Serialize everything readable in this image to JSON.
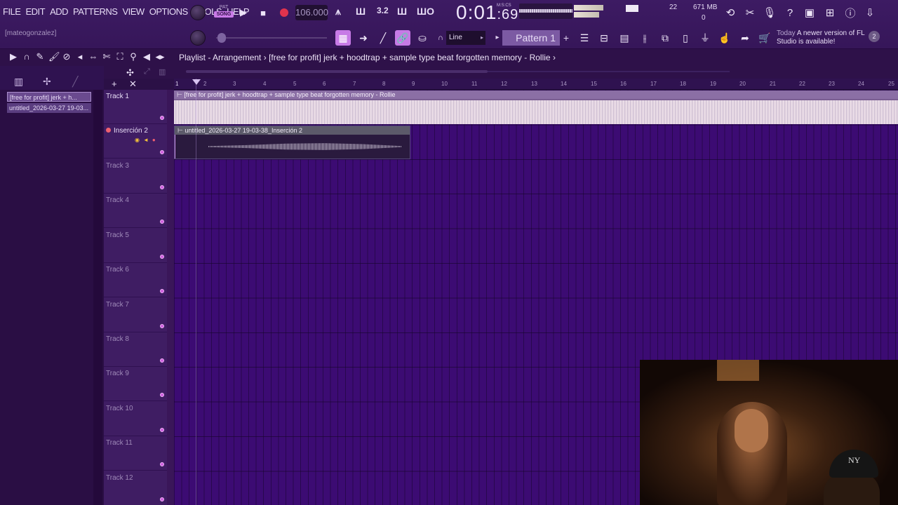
{
  "menu": [
    "FILE",
    "EDIT",
    "ADD",
    "PATTERNS",
    "VIEW",
    "OPTIONS",
    "TOOLS",
    "HELP"
  ],
  "user": "[mateogonzalez]",
  "transport": {
    "pat_label": "PAT",
    "song_label": "SONG",
    "tempo": "106.000",
    "clock_main": "0:01",
    "clock_ms": ":69",
    "clock_tag": "M:S:CS"
  },
  "meters": {
    "cpu_value": "22",
    "memory": "671 MB",
    "polyphony": "0"
  },
  "snap": {
    "value": "Line"
  },
  "pattern": {
    "name": "Pattern 1"
  },
  "news": {
    "today": "Today",
    "message": "A newer version of FL Studio is available!",
    "badge": "2"
  },
  "playlist": {
    "title": "Playlist - Arrangement",
    "separator": "›",
    "current_clip": "[free for profit] jerk + hoodtrap + sample type beat forgotten memory - Rollie"
  },
  "clip_browser": [
    "[free for profit] jerk + h...",
    "untitled_2026-03-27 19-03..."
  ],
  "ruler": [
    "2",
    "3",
    "4",
    "5",
    "6",
    "7",
    "8",
    "9",
    "10",
    "11",
    "12",
    "13",
    "14",
    "15",
    "16",
    "17",
    "18",
    "19",
    "20",
    "21",
    "22",
    "23",
    "24",
    "25"
  ],
  "tracks": [
    {
      "name": "Track 1"
    },
    {
      "name": "Inserción 2"
    },
    {
      "name": "Track 3"
    },
    {
      "name": "Track 4"
    },
    {
      "name": "Track 5"
    },
    {
      "name": "Track 6"
    },
    {
      "name": "Track 7"
    },
    {
      "name": "Track 8"
    },
    {
      "name": "Track 9"
    },
    {
      "name": "Track 10"
    },
    {
      "name": "Track 11"
    },
    {
      "name": "Track 12"
    }
  ],
  "clips": {
    "clip1_title": "[free for profit] jerk + hoodtrap + sample type beat forgotten memory - Rollie",
    "clip2_title": "untitled_2026-03-27 19-03-38_Inserción 2"
  },
  "colors": {
    "accent": "#c77ae6",
    "grid": "#3c0b73",
    "record": "#e0334d"
  }
}
